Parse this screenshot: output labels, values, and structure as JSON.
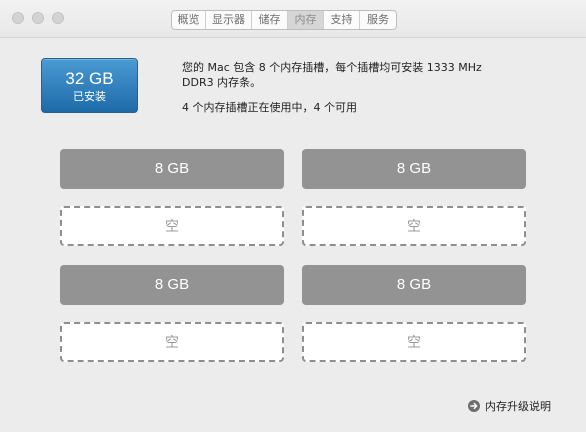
{
  "tabs": [
    {
      "label": "概览"
    },
    {
      "label": "显示器"
    },
    {
      "label": "储存"
    },
    {
      "label": "内存"
    },
    {
      "label": "支持"
    },
    {
      "label": "服务"
    }
  ],
  "active_tab": "内存",
  "memory": {
    "total_size": "32 GB",
    "total_label": "已安装",
    "description": "您的 Mac 包含 8 个内存插槽，每个插槽均可安装 1333 MHz DDR3 内存条。",
    "usage": "4 个内存插槽正在使用中，4 个可用",
    "slots": [
      {
        "label": "8 GB",
        "state": "filled"
      },
      {
        "label": "8 GB",
        "state": "filled"
      },
      {
        "label": "空",
        "state": "empty"
      },
      {
        "label": "空",
        "state": "empty"
      },
      {
        "label": "8 GB",
        "state": "filled"
      },
      {
        "label": "8 GB",
        "state": "filled"
      },
      {
        "label": "空",
        "state": "empty"
      },
      {
        "label": "空",
        "state": "empty"
      }
    ],
    "upgrade_link": "内存升级说明"
  },
  "colors": {
    "badge": "#2a7fc0",
    "filled_slot": "#939393",
    "empty_slot_border": "#8e8e8e"
  }
}
